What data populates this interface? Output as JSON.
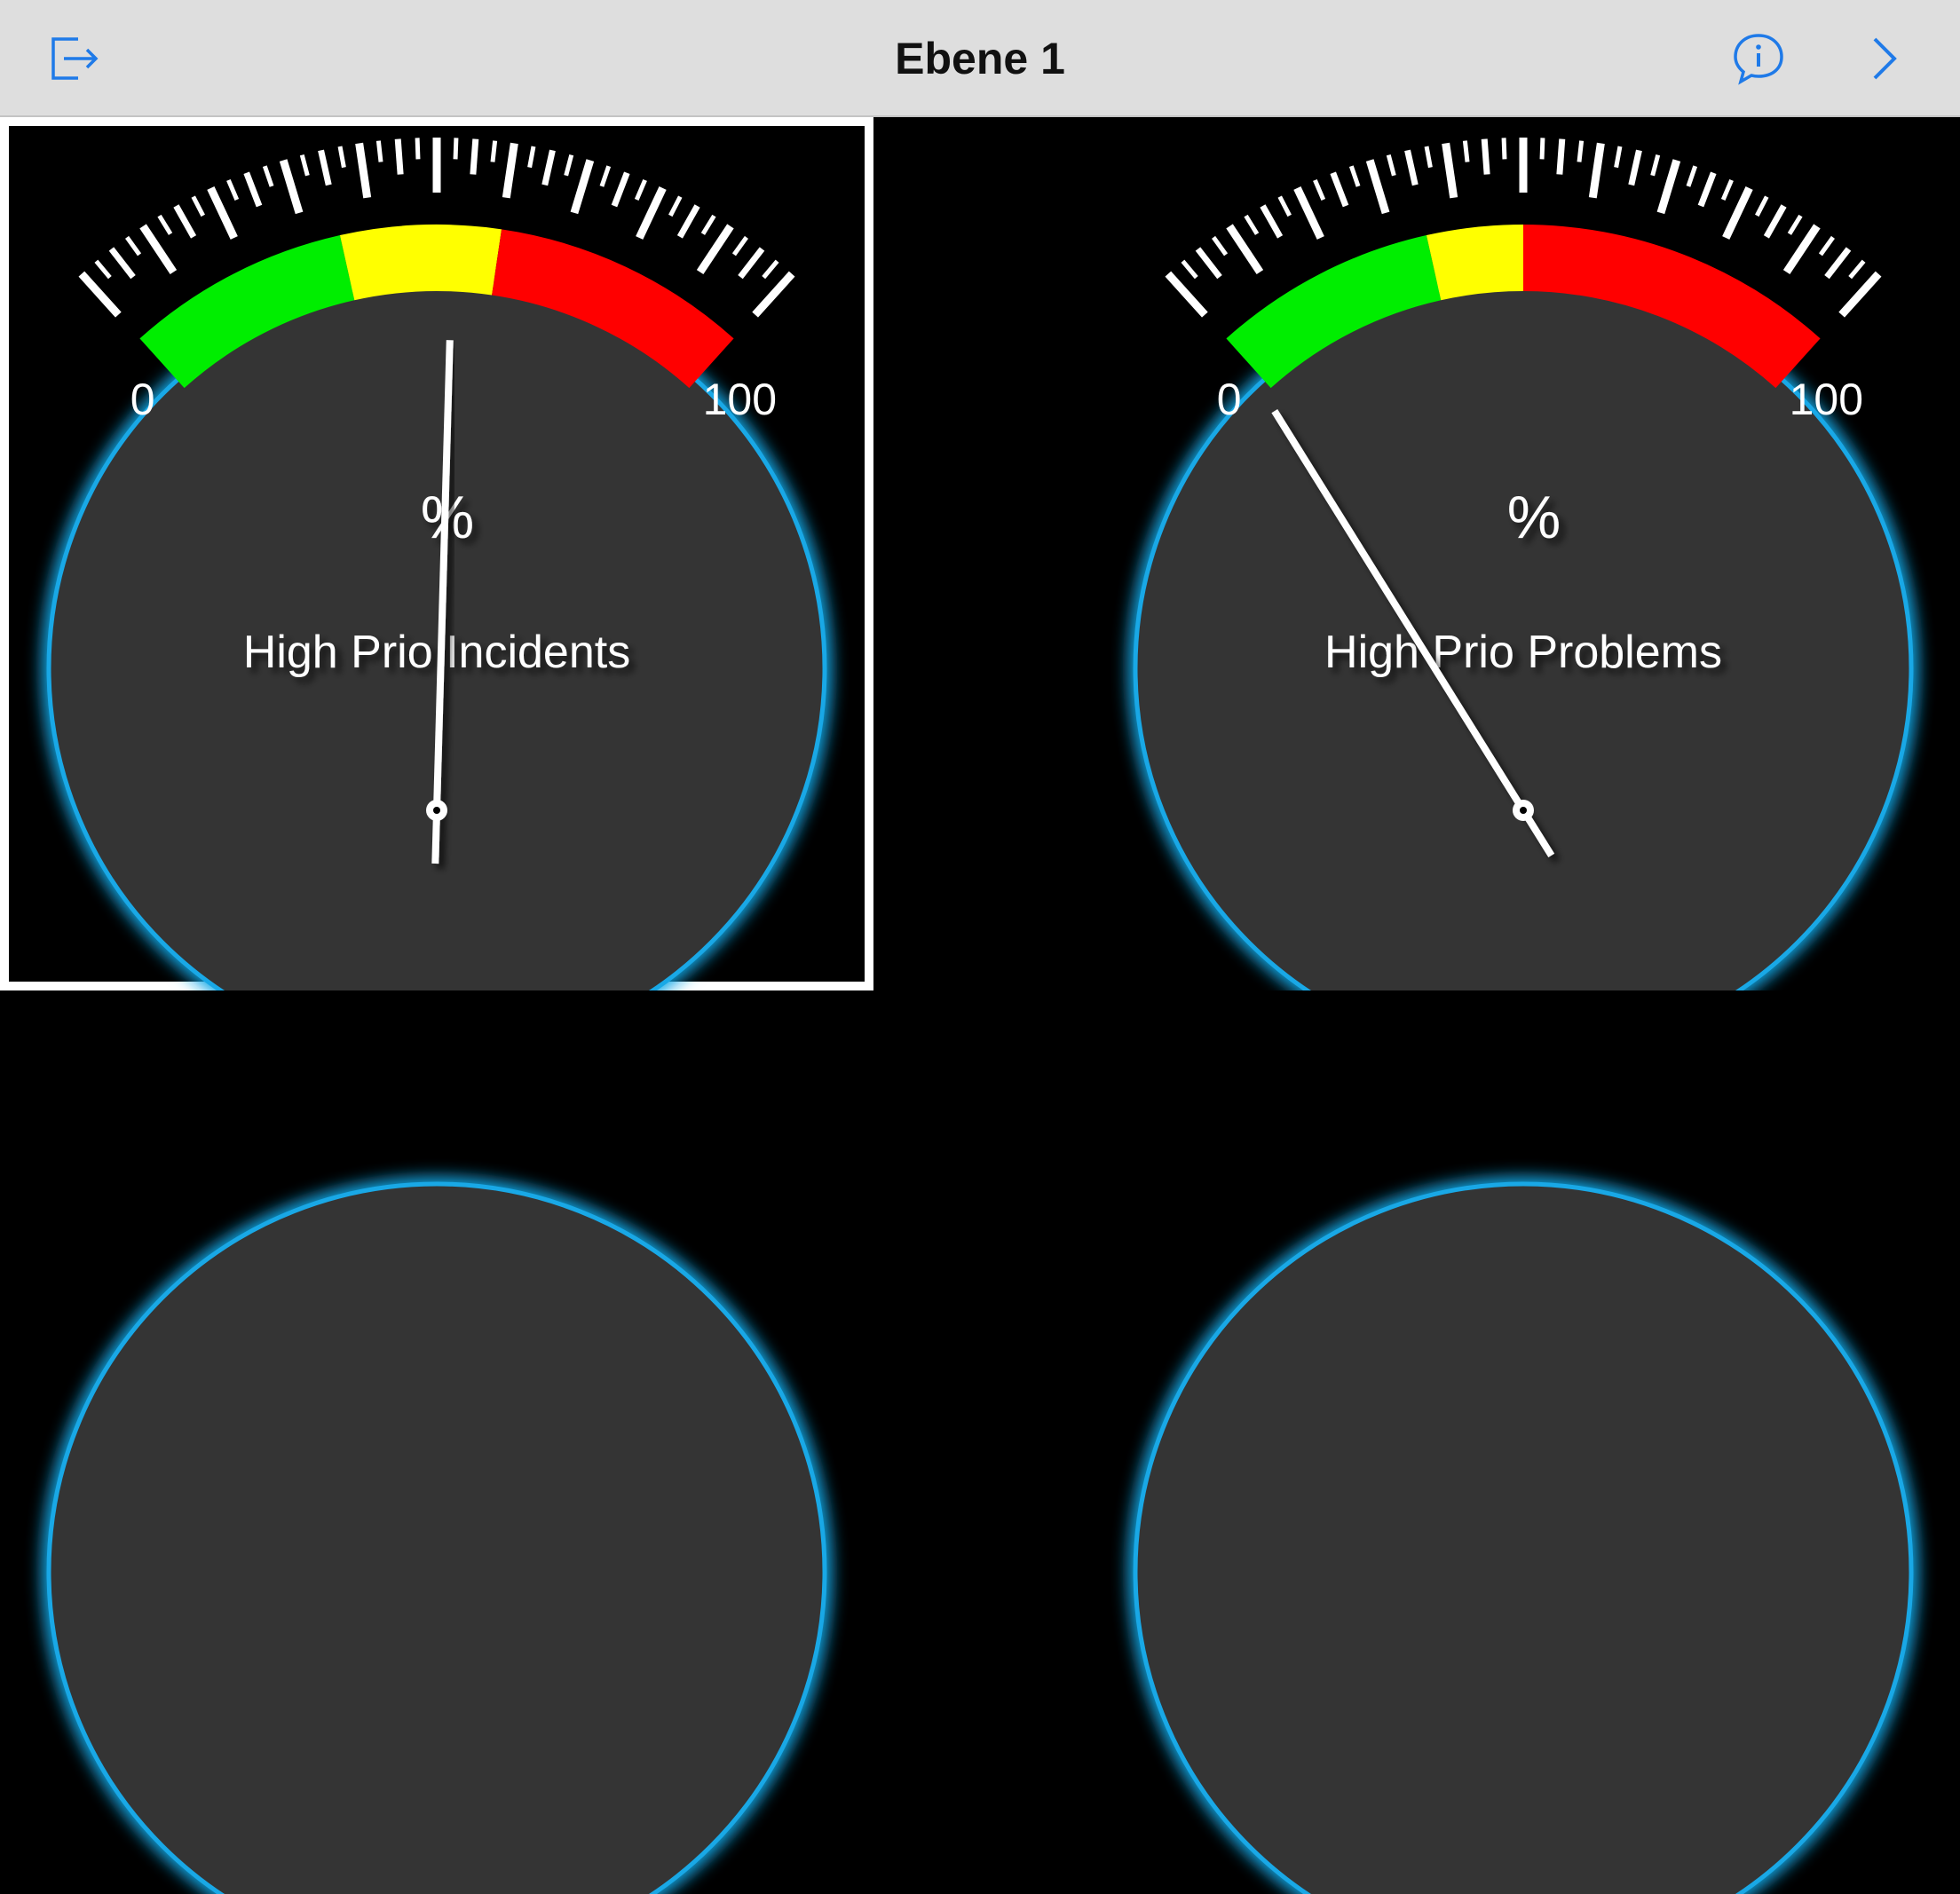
{
  "navbar": {
    "title": "Ebene 1",
    "exit_icon": "exit-icon",
    "info_icon": "info-bubble-icon",
    "next_icon": "chevron-right-icon",
    "accent": "#1f7ae8"
  },
  "gauges": [
    {
      "title": "High Prio Incidents",
      "unit": "%",
      "min_label": "0",
      "max_label": "100",
      "value": 52,
      "selected": true,
      "bands": [
        {
          "from": 0,
          "to": 35,
          "color": "#00ee00"
        },
        {
          "from": 35,
          "to": 60,
          "color": "#ffff00"
        },
        {
          "from": 60,
          "to": 100,
          "color": "#ff0000"
        }
      ]
    },
    {
      "title": "High Prio Problems",
      "unit": "%",
      "min_label": "0",
      "max_label": "100",
      "value": 10,
      "selected": false,
      "bands": [
        {
          "from": 0,
          "to": 35,
          "color": "#00ee00"
        },
        {
          "from": 35,
          "to": 50,
          "color": "#ffff00"
        },
        {
          "from": 50,
          "to": 100,
          "color": "#ff0000"
        }
      ]
    },
    {
      "title": "",
      "unit": "",
      "min_label": "",
      "max_label": "",
      "value": null,
      "selected": false,
      "bands": []
    },
    {
      "title": "",
      "unit": "",
      "min_label": "",
      "max_label": "",
      "value": null,
      "selected": false,
      "bands": []
    }
  ],
  "colors": {
    "face": "#343434",
    "rim_glow": "#19a8e6",
    "tick": "#ffffff",
    "needle": "#ffffff"
  }
}
